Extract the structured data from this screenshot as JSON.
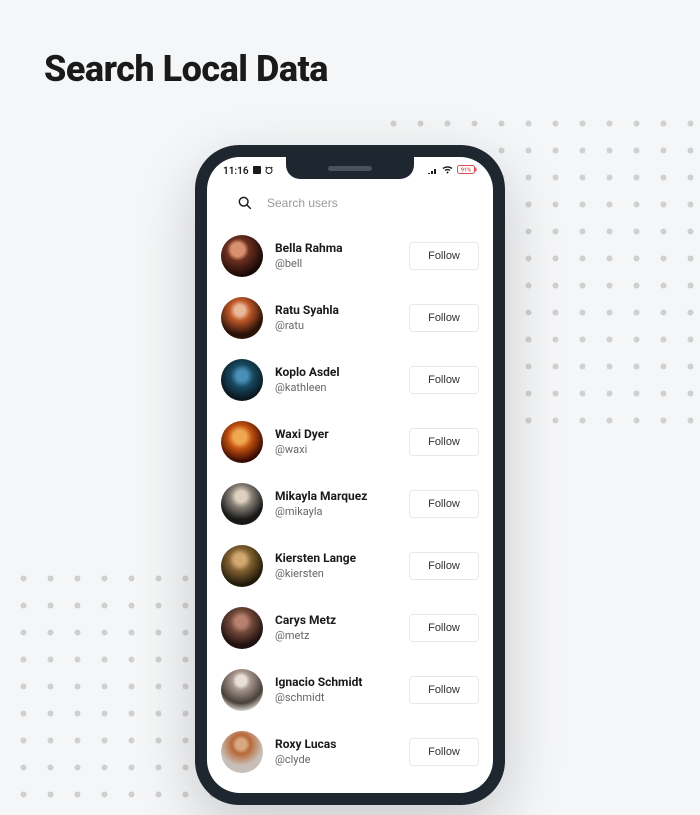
{
  "page": {
    "title": "Search Local Data"
  },
  "statusBar": {
    "time": "11:16",
    "battery": "91%"
  },
  "search": {
    "placeholder": "Search users"
  },
  "followLabel": "Follow",
  "users": [
    {
      "name": "Bella Rahma",
      "handle": "@bell"
    },
    {
      "name": "Ratu Syahla",
      "handle": "@ratu"
    },
    {
      "name": "Koplo Asdel",
      "handle": "@kathleen"
    },
    {
      "name": "Waxi Dyer",
      "handle": "@waxi"
    },
    {
      "name": "Mikayla Marquez",
      "handle": "@mikayla"
    },
    {
      "name": "Kiersten Lange",
      "handle": "@kiersten"
    },
    {
      "name": "Carys Metz",
      "handle": "@metz"
    },
    {
      "name": "Ignacio Schmidt",
      "handle": "@schmidt"
    },
    {
      "name": "Roxy Lucas",
      "handle": "@clyde"
    }
  ]
}
